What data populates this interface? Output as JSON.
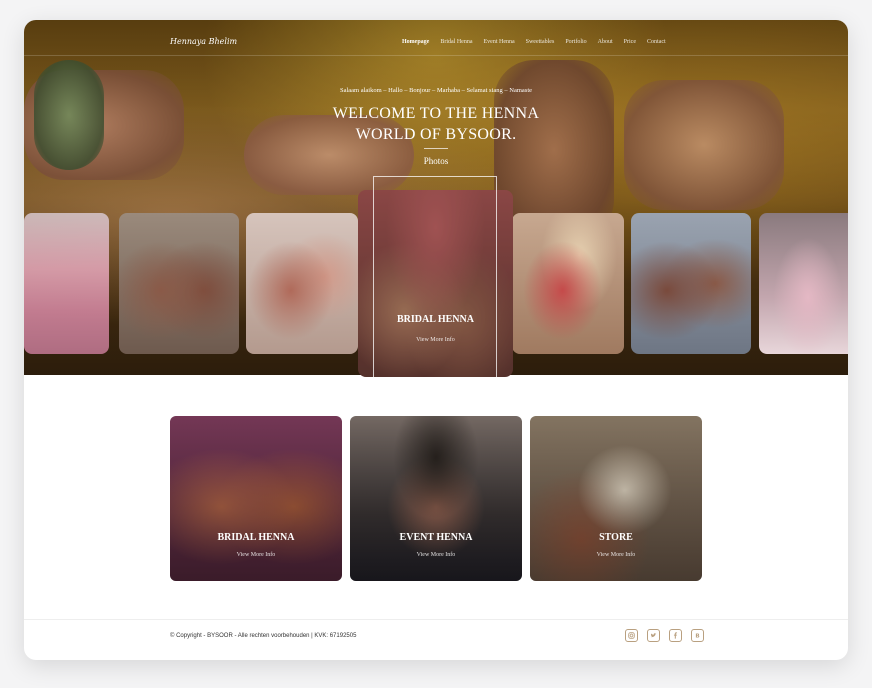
{
  "brand": {
    "logo_text": "Hennaya Bhelim"
  },
  "nav": {
    "items": [
      {
        "label": "Homepage",
        "active": true
      },
      {
        "label": "Bridal Henna",
        "active": false
      },
      {
        "label": "Event Henna",
        "active": false
      },
      {
        "label": "Sweettables",
        "active": false
      },
      {
        "label": "Portfolio",
        "active": false
      },
      {
        "label": "About",
        "active": false
      },
      {
        "label": "Price",
        "active": false
      },
      {
        "label": "Contact",
        "active": false
      }
    ]
  },
  "hero": {
    "greeting": "Salaam alaikom – Hallo – Bonjour – Marhaba – Selamat siang – Namaste",
    "title_line1": "WELCOME TO THE HENNA",
    "title_line2": "WORLD OF BYSOOR.",
    "subtitle": "Photos"
  },
  "carousel": {
    "center": {
      "title": "BRIDAL HENNA",
      "link": "View More Info"
    }
  },
  "categories": [
    {
      "title": "BRIDAL HENNA",
      "link": "View More Info"
    },
    {
      "title": "EVENT HENNA",
      "link": "View More Info"
    },
    {
      "title": "STORE",
      "link": "View More Info"
    }
  ],
  "footer": {
    "copyright": "© Copyright - BYSOOR - Alle rechten voorbehouden | KVK: 67192505",
    "socials": [
      "instagram-icon",
      "twitter-icon",
      "facebook-icon",
      "blog-icon"
    ]
  },
  "colors": {
    "accent": "#b9a080",
    "white": "#ffffff"
  }
}
